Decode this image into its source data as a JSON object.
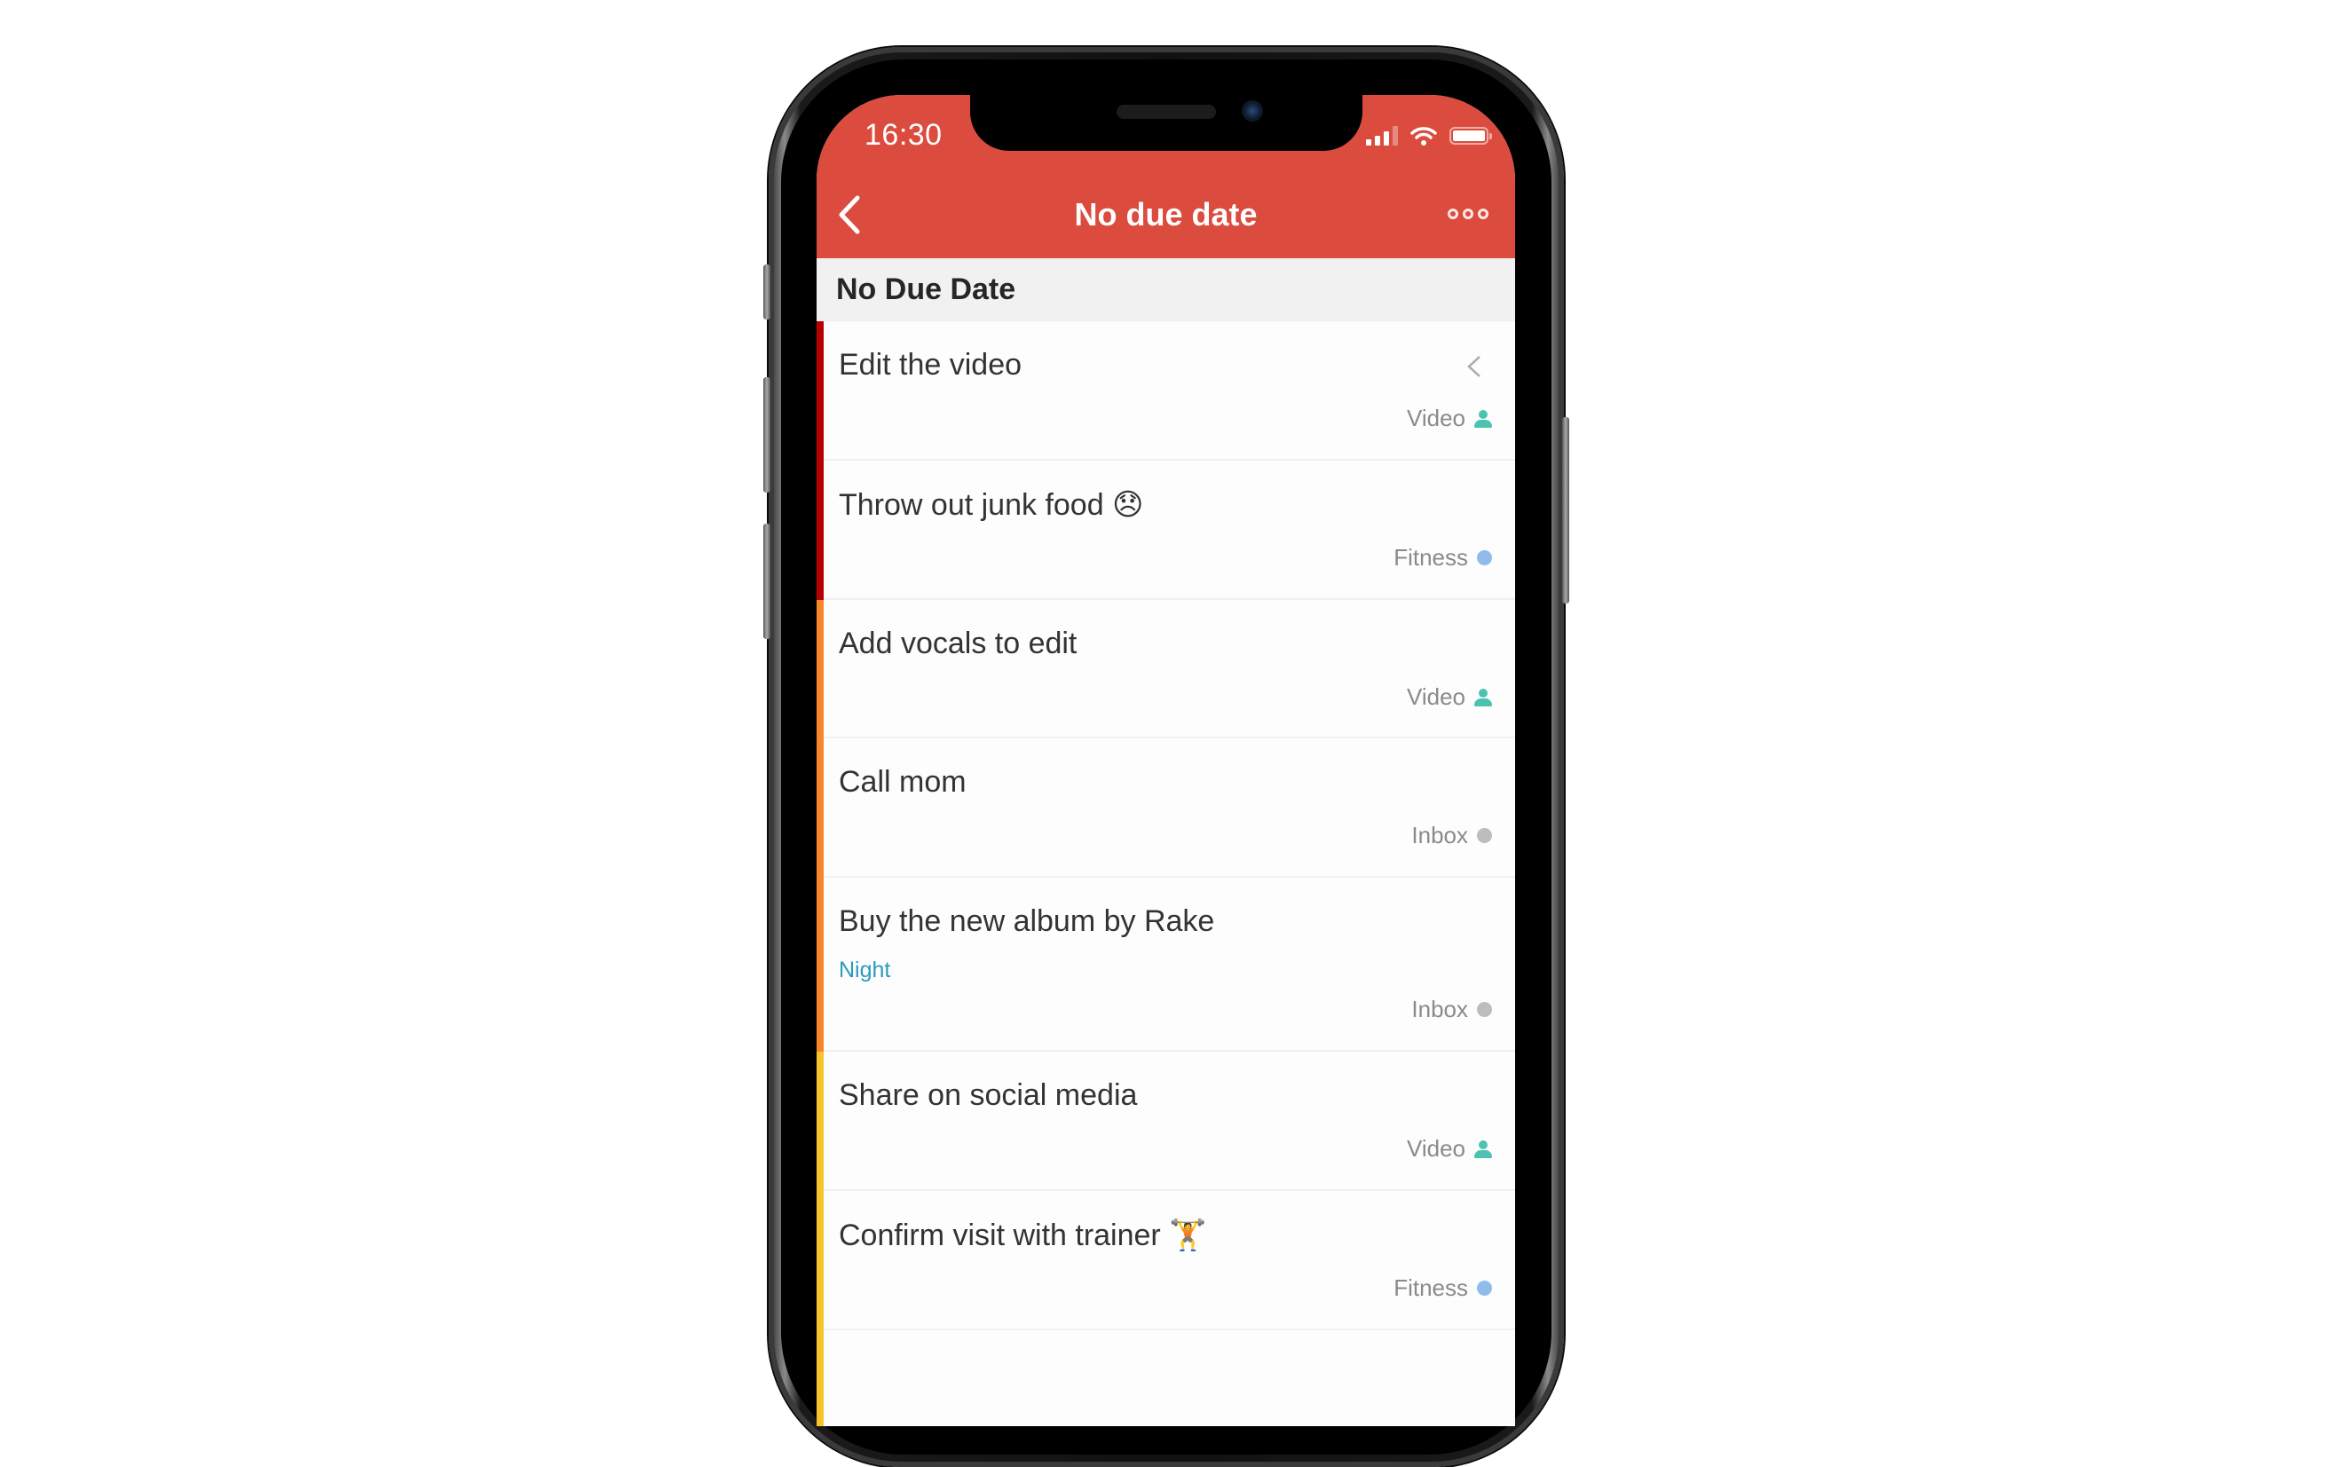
{
  "status_bar": {
    "time": "16:30",
    "signal_bars": 3,
    "signal_total": 4,
    "wifi": "wifi-icon",
    "battery_level": 1.0
  },
  "header": {
    "title": "No due date",
    "back_icon": "chevron-left-icon",
    "more_icon": "more-icon"
  },
  "section": {
    "title": "No Due Date"
  },
  "tasks": [
    {
      "name": "Edit the video",
      "project": "Video",
      "project_icon": "person-icon",
      "priority_color": "#b50000",
      "swipe_hint": true
    },
    {
      "name": "Throw out junk food 😞",
      "project": "Fitness",
      "project_icon": "dot",
      "project_color": "#8fbcea",
      "priority_color": "#b50000"
    },
    {
      "name": "Add vocals to edit",
      "project": "Video",
      "project_icon": "person-icon",
      "priority_color": "#f7882a"
    },
    {
      "name": "Call mom",
      "project": "Inbox",
      "project_icon": "dot",
      "project_color": "#bdbdbd",
      "priority_color": "#f7882a"
    },
    {
      "name": "Buy the new album by Rake",
      "label": "Night",
      "project": "Inbox",
      "project_icon": "dot",
      "project_color": "#bdbdbd",
      "priority_color": "#f7882a"
    },
    {
      "name": "Share on social media",
      "project": "Video",
      "project_icon": "person-icon",
      "priority_color": "#f8c22c"
    },
    {
      "name": "Confirm visit with trainer 🏋️",
      "project": "Fitness",
      "project_icon": "dot",
      "project_color": "#8fbcea",
      "priority_color": "#f8c22c"
    },
    {
      "name": "",
      "project": "",
      "priority_color": "#f8c22c"
    }
  ],
  "colors": {
    "brand": "#db4c3f",
    "section_bg": "#f1f1f1",
    "label_blue": "#2a9bc0",
    "video_teal": "#4cc3b0"
  }
}
